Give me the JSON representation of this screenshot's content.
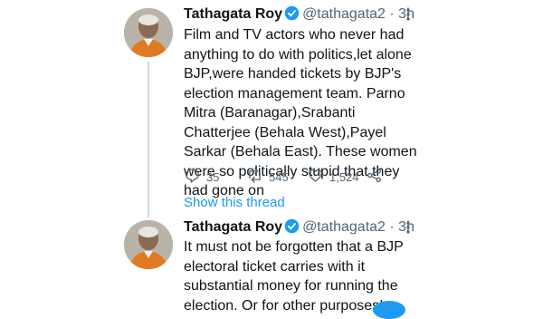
{
  "tweets": [
    {
      "author_name": "Tathagata Roy",
      "handle": "@tathagata2",
      "separator": "·",
      "time": "3h",
      "text": "Film and TV actors who never had anything to do with politics,let alone BJP,were handed tickets by BJP's election management team. Parno Mitra (Baranagar),Srabanti Chatterjee (Behala West),Payel Sarkar (Behala East). These women were so politically stupid that they had gone on",
      "replies": "35",
      "retweets": "545",
      "likes": "1,524"
    },
    {
      "author_name": "Tathagata Roy",
      "handle": "@tathagata2",
      "separator": "·",
      "time": "3h",
      "text": "It must not be forgotten that a BJP electoral ticket carries with it substantial money for running the election. Or for other purposes!"
    }
  ],
  "show_thread": "Show this thread",
  "icons": {
    "verified": "verified-badge-icon",
    "more": "more-options-icon",
    "reply": "reply-icon",
    "retweet": "retweet-icon",
    "like": "heart-icon",
    "share": "share-icon"
  },
  "colors": {
    "accent": "#1d9bf0",
    "muted": "#536471",
    "text": "#0f1419"
  }
}
